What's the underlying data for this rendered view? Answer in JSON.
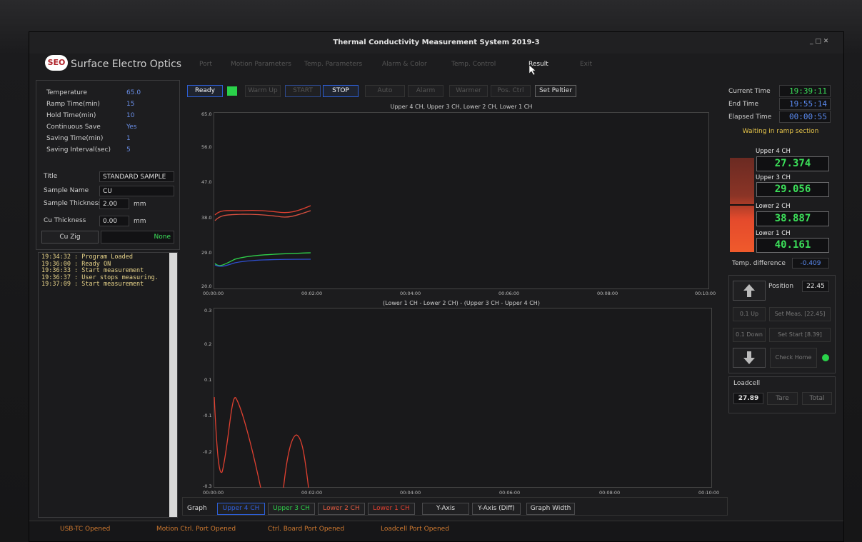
{
  "window": {
    "title": "Thermal Conductivity Measurement System  2019-3",
    "controls": "_ □ ✕"
  },
  "brand": {
    "badge": "SEO",
    "name": "Surface Electro Optics"
  },
  "menu": [
    "Port",
    "Motion Parameters",
    "Temp. Parameters",
    "Alarm & Color",
    "Temp. Control",
    "Result",
    "Exit"
  ],
  "params": [
    {
      "label": "Temperature",
      "value": "65.0"
    },
    {
      "label": "Ramp Time(min)",
      "value": "15"
    },
    {
      "label": "Hold Time(min)",
      "value": "10"
    },
    {
      "label": "Continuous Save",
      "value": "Yes"
    },
    {
      "label": "Saving Time(min)",
      "value": "1"
    },
    {
      "label": "Saving Interval(sec)",
      "value": "5"
    }
  ],
  "sample": {
    "title_label": "Title",
    "title_value": "STANDARD SAMPLE",
    "name_label": "Sample Name",
    "name_value": "CU",
    "thickness_label": "Sample Thickness",
    "thickness_value": "2.00",
    "thickness_unit": "mm",
    "cu_label": "Cu Thickness",
    "cu_value": "0.00",
    "cu_unit": "mm",
    "zig_button": "Cu Zig",
    "zig_status": "None"
  },
  "log": [
    "19:34:32 : Program Loaded",
    "19:36:00 : Ready ON",
    "19:36:33 : Start measurement",
    "19:36:37 : User stops measuring.",
    "19:37:09 : Start measurement"
  ],
  "toolbar": {
    "ready": "Ready",
    "warmup": "Warm Up",
    "start": "START",
    "stop": "STOP",
    "auto": "Auto",
    "alarm": "Alarm",
    "warmer": "Warmer",
    "pos_ctrl": "Pos. Ctrl",
    "set_peltier": "Set Peltier"
  },
  "graphs": {
    "top_title": "Upper 4 CH, Upper 3 CH, Lower 2 CH, Lower 1 CH",
    "bottom_title": "(Lower 1 CH - Lower 2 CH) - (Upper 3 CH - Upper 4 CH)",
    "x_ticks": [
      "00:00:00",
      "00:02:00",
      "00:04:00",
      "00:06:00",
      "00:08:00",
      "00:10:00"
    ],
    "top_y_ticks": [
      "65.0",
      "56.0",
      "47.0",
      "38.0",
      "29.0",
      "20.0"
    ],
    "bottom_y_ticks": [
      "0.3",
      "0.2",
      "0.1",
      "-0.1",
      "-0.2",
      "-0.3"
    ],
    "colors": {
      "upper4": "#2f4fd0",
      "upper3": "#2fd04a",
      "lower2": "#d85040",
      "lower1": "#e04030"
    }
  },
  "graph_bar": {
    "label": "Graph",
    "upper4": "Upper 4 CH",
    "upper3": "Upper 3 CH",
    "lower2": "Lower 2 CH",
    "lower1": "Lower 1 CH",
    "yaxis": "Y-Axis",
    "yaxis_diff": "Y-Axis (Diff)",
    "width": "Graph Width"
  },
  "times": {
    "current_label": "Current Time",
    "current": "19:39:11",
    "end_label": "End Time",
    "end": "19:55:14",
    "elapsed_label": "Elapsed Time",
    "elapsed": "00:00:55",
    "status": "Waiting in ramp section"
  },
  "channels": [
    {
      "label": "Upper 4 CH",
      "value": "27.374"
    },
    {
      "label": "Upper 3 CH",
      "value": "29.056"
    },
    {
      "label": "Lower 2 CH",
      "value": "38.887"
    },
    {
      "label": "Lower 1 CH",
      "value": "40.161"
    }
  ],
  "temp_diff": {
    "label": "Temp. difference",
    "value": "-0.409"
  },
  "motion": {
    "position_label": "Position",
    "position": "22.45",
    "up": "0.1 Up",
    "down": "0.1 Down",
    "set_meas": "Set Meas. [22.45]",
    "set_start": "Set Start [8.39]",
    "check_home": "Check Home"
  },
  "loadcell": {
    "label": "Loadcell",
    "value": "27.89",
    "tare": "Tare",
    "total": "Total"
  },
  "statusbar": [
    "USB-TC Opened",
    "Motion Ctrl. Port Opened",
    "Ctrl. Board Port Opened",
    "Loadcell Port Opened"
  ]
}
